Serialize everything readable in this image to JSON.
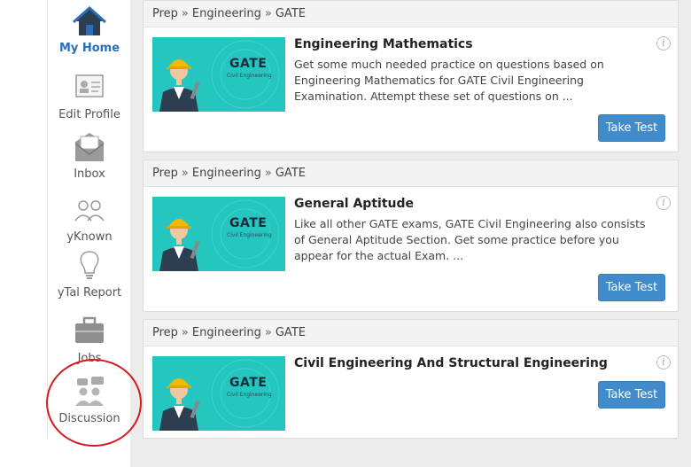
{
  "sidebar": {
    "items": [
      {
        "label": "My Home",
        "icon": "home-icon",
        "active": true
      },
      {
        "label": "Edit Profile",
        "icon": "profile-card-icon"
      },
      {
        "label": "Inbox",
        "icon": "envelope-icon"
      },
      {
        "label": "yKnown",
        "icon": "people-icon"
      },
      {
        "label": "yTal Report",
        "icon": "lightbulb-icon"
      },
      {
        "label": "Jobs",
        "icon": "briefcase-icon"
      },
      {
        "label": "Discussion",
        "icon": "discussion-icon"
      }
    ]
  },
  "cards": [
    {
      "breadcrumb": [
        "Prep",
        "Engineering",
        "GATE"
      ],
      "thumb": {
        "title": "GATE",
        "subtitle": "Civil Engineering"
      },
      "title": "Engineering Mathematics",
      "description": "Get some much needed practice on questions based on Engineering Mathematics for GATE Civil Engineering Examination. Attempt these set of questions on ...",
      "button": "Take Test",
      "info": "i"
    },
    {
      "breadcrumb": [
        "Prep",
        "Engineering",
        "GATE"
      ],
      "thumb": {
        "title": "GATE",
        "subtitle": "Civil Engineering"
      },
      "title": "General Aptitude",
      "description": "Like all other GATE exams, GATE Civil Engineering also consists of General Aptitude Section. Get some practice before you appear for the actual Exam. ...",
      "button": "Take Test",
      "info": "i"
    },
    {
      "breadcrumb": [
        "Prep",
        "Engineering",
        "GATE"
      ],
      "thumb": {
        "title": "GATE",
        "subtitle": "Civil Engineering"
      },
      "title": "Civil Engineering And Structural Engineering",
      "description": "",
      "button": "Take Test",
      "info": "i"
    }
  ],
  "colors": {
    "accent": "#2a6ebb",
    "button": "#428bca",
    "thumb": "#26c6c0",
    "highlight_circle": "#d71920"
  }
}
